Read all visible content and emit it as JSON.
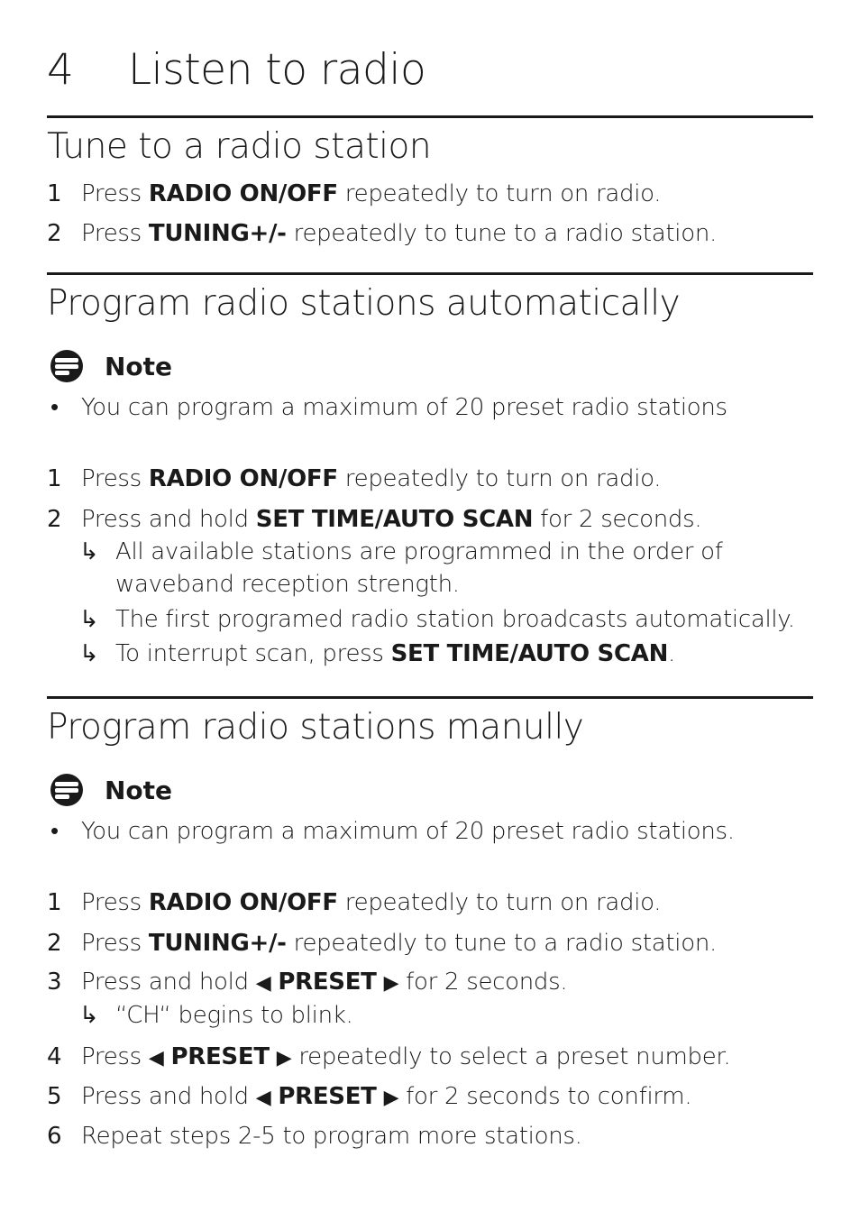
{
  "chapter": {
    "number": "4",
    "title": "Listen to radio"
  },
  "sections": [
    {
      "title": "Tune to a radio station",
      "steps": [
        {
          "n": "1",
          "pre": "Press ",
          "key": "RADIO ON/OFF",
          "post": " repeatedly to turn on radio."
        },
        {
          "n": "2",
          "pre": "Press ",
          "key": "TUNING+/-",
          "post": " repeatedly to tune to a radio station."
        }
      ]
    },
    {
      "title": "Program radio stations automatically",
      "note_label": "Note",
      "note_text": "You can program a maximum of 20 preset radio stations",
      "steps": [
        {
          "n": "1",
          "pre": "Press ",
          "key": "RADIO ON/OFF",
          "post": " repeatedly to turn on radio."
        },
        {
          "n": "2",
          "pre": "Press and hold ",
          "key": "SET TIME/AUTO SCAN",
          "post": " for 2 seconds."
        }
      ],
      "results": [
        {
          "line1": "All available stations are programmed in the order of",
          "line2": "waveband reception strength."
        },
        {
          "line1": "The first programed radio station broadcasts automatically."
        },
        {
          "pre": "To interrupt scan, press ",
          "key": "SET TIME/AUTO SCAN",
          "post": "."
        }
      ]
    },
    {
      "title": "Program radio stations manully",
      "note_label": "Note",
      "note_text": "You can program a maximum of 20 preset radio stations.",
      "steps": [
        {
          "n": "1",
          "pre": "Press ",
          "key": "RADIO ON/OFF",
          "post": " repeatedly to turn on radio."
        },
        {
          "n": "2",
          "pre": "Press ",
          "key": "TUNING+/-",
          "post": " repeatedly to tune to a radio station."
        },
        {
          "n": "3",
          "pre": "Press and hold ",
          "key": "PRESET",
          "post": " for 2 seconds.",
          "result": "“CH“ begins to blink."
        },
        {
          "n": "4",
          "pre": "Press ",
          "key": "PRESET",
          "post": " repeatedly to select a preset number."
        },
        {
          "n": "5",
          "pre": "Press and hold ",
          "key": "PRESET",
          "post": " for 2 seconds to confirm."
        },
        {
          "n": "6",
          "text": "Repeat steps 2-5 to program more stations."
        }
      ]
    }
  ],
  "icons": {
    "arrow": "↳",
    "left": "◀",
    "right": "▶",
    "bullet": "•"
  }
}
